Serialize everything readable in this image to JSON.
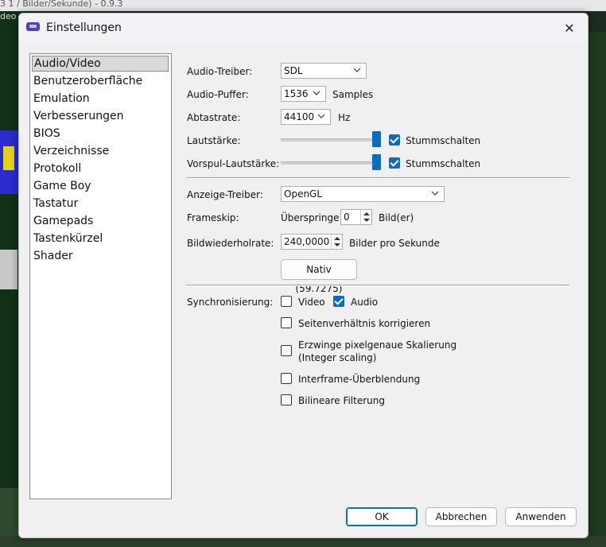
{
  "background": {
    "window_title_fragment": "3 1 / Bilder/Sekunde) - 0.9.3",
    "left_fragment": "deo"
  },
  "dialog": {
    "title": "Einstellungen",
    "close_glyph": "✕"
  },
  "nav": {
    "items": [
      "Audio/Video",
      "Benutzeroberfläche",
      "Emulation",
      "Verbesserungen",
      "BIOS",
      "Verzeichnisse",
      "Protokoll",
      "Game Boy",
      "Tastatur",
      "Gamepads",
      "Tastenkürzel",
      "Shader"
    ],
    "selected": "Audio/Video"
  },
  "audio": {
    "driver_label": "Audio-Treiber:",
    "driver_value": "SDL",
    "buffer_label": "Audio-Puffer:",
    "buffer_value": "1536",
    "buffer_unit": "Samples",
    "rate_label": "Abtastrate:",
    "rate_value": "44100",
    "rate_unit": "Hz",
    "volume_label": "Lautstärke:",
    "volume_level": 1.0,
    "volume_mute_label": "Stummschalten",
    "volume_muted": true,
    "ff_volume_label": "Vorspul-Lautstärke:",
    "ff_volume_level": 1.0,
    "ff_mute_label": "Stummschalten",
    "ff_muted": true
  },
  "video": {
    "driver_label": "Anzeige-Treiber:",
    "driver_value": "OpenGL",
    "frameskip_label": "Frameskip:",
    "frameskip_prefix": "Überspringe",
    "frameskip_value": "0",
    "frameskip_suffix": "Bild(er)",
    "fps_label": "Bildwiederholrate:",
    "fps_value": "240,0000",
    "fps_unit": "Bilder pro Sekunde",
    "native_button": "Nativ (59.7275)"
  },
  "sync": {
    "label": "Synchronisierung:",
    "video_label": "Video",
    "video_checked": false,
    "audio_label": "Audio",
    "audio_checked": true,
    "aspect_label": "Seitenverhältnis korrigieren",
    "aspect_checked": false,
    "integer_label_1": "Erzwinge pixelgenaue Skalierung",
    "integer_label_2": "(Integer scaling)",
    "integer_checked": false,
    "interframe_label": "Interframe-Überblendung",
    "interframe_checked": false,
    "bilinear_label": "Bilineare Filterung",
    "bilinear_checked": false
  },
  "buttons": {
    "ok": "OK",
    "cancel": "Abbrechen",
    "apply": "Anwenden"
  },
  "colors": {
    "accent": "#0f6cbd",
    "dialog_bg": "#f0f0f0",
    "title_bg": "#f3f2f7"
  }
}
